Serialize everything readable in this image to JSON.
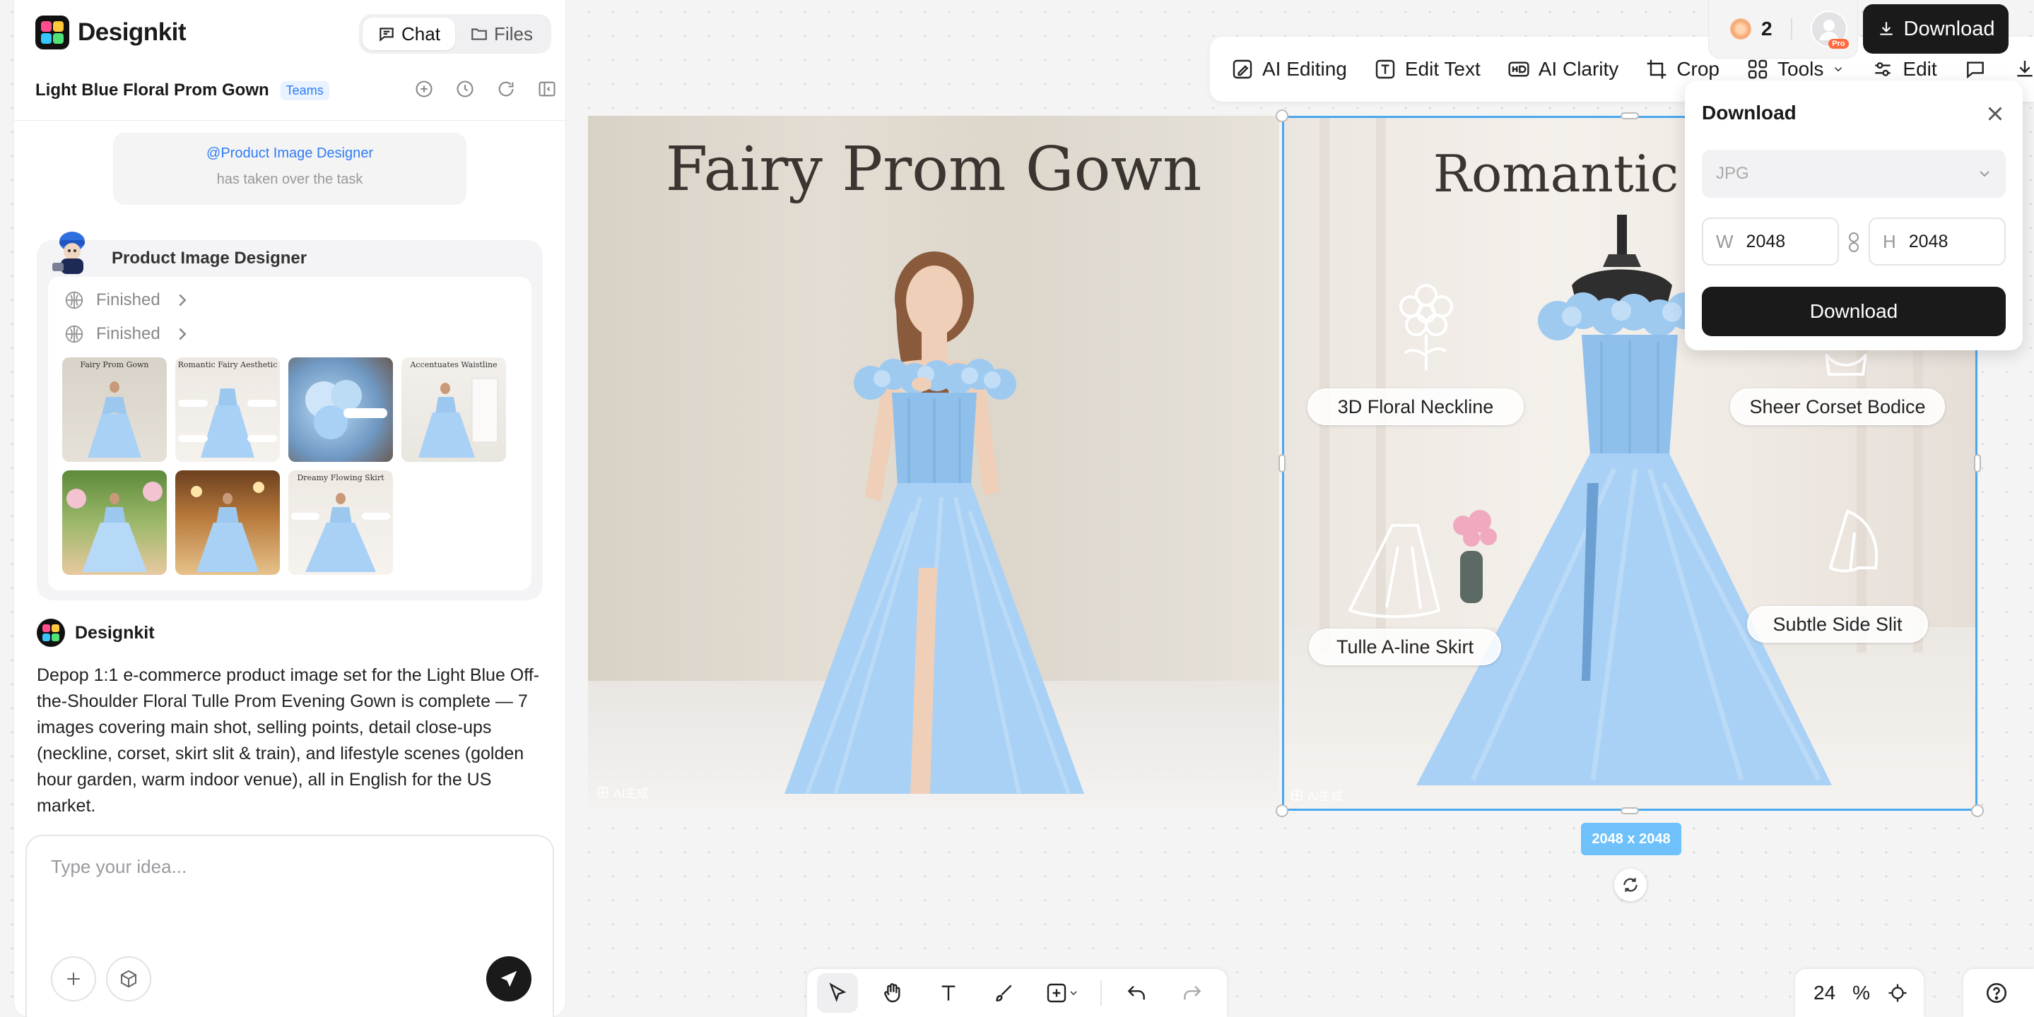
{
  "app": {
    "brand": "Designkit"
  },
  "tabs": {
    "chat": "Chat",
    "files": "Files"
  },
  "project": {
    "title": "Light Blue Floral Prom Gown",
    "badge": "Teams"
  },
  "takeover": {
    "mention": "@Product Image Designer",
    "message": "has taken over the task"
  },
  "agent": {
    "name": "Product Image Designer",
    "steps": [
      "Finished",
      "Finished"
    ],
    "thumbnails": [
      {
        "caption": "Fairy Prom Gown"
      },
      {
        "caption": "Romantic Fairy Aesthetic"
      },
      {
        "caption": ""
      },
      {
        "caption": "Accentuates Waistline"
      },
      {
        "caption": ""
      },
      {
        "caption": ""
      },
      {
        "caption": "Dreamy Flowing Skirt"
      }
    ]
  },
  "reply": {
    "author": "Designkit",
    "text": "Depop 1:1 e-commerce product image set for the Light Blue Off-the-Shoulder Floral Tulle Prom Evening Gown is complete — 7 images covering main shot, selling points, detail close-ups (neckline, corset, skirt slit & train), and lifestyle scenes (golden hour garden, warm indoor venue), all in English for the US market."
  },
  "input": {
    "placeholder": "Type your idea..."
  },
  "toolbar": {
    "items": [
      "AI Editing",
      "Edit Text",
      "AI Clarity",
      "Crop",
      "Tools",
      "Edit"
    ]
  },
  "credits": {
    "count": "2",
    "pro_label": "Pro"
  },
  "download_button": "Download",
  "download_popup": {
    "title": "Download",
    "format": "JPG",
    "width_label": "W",
    "width": "2048",
    "height_label": "H",
    "height": "2048",
    "button": "Download"
  },
  "canvas": {
    "image1": {
      "title": "Fairy Prom Gown",
      "ai_tag": "AI生成"
    },
    "image2": {
      "title": "Romantic Fairy",
      "ai_tag": "AI生成",
      "features": [
        "3D Floral Neckline",
        "Sheer Corset Bodice",
        "Tulle A-line Skirt",
        "Subtle Side Slit"
      ]
    },
    "size_badge": "2048 x 2048"
  },
  "zoom": {
    "value": "24",
    "unit": "%"
  },
  "colors": {
    "accent": "#2f7bf6",
    "selection": "#4aa8f0",
    "dress_blue": "#a9d1f5",
    "dark": "#1a1a1a"
  }
}
